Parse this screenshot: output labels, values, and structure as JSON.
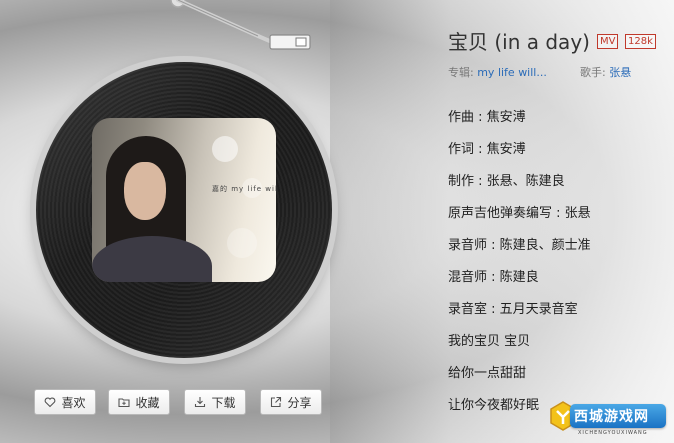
{
  "song": {
    "title": "宝贝 (in a day)",
    "badges": [
      "MV",
      "128k"
    ]
  },
  "meta": {
    "album_label": "专辑:",
    "album_value": "my life will...",
    "singer_label": "歌手:",
    "singer_value": "张悬"
  },
  "cover_text": "嘉的 my life will",
  "lyrics": [
    "作曲 : 焦安溥",
    "作词 : 焦安溥",
    "制作 : 张悬、陈建良",
    "原声吉他弹奏编写 : 张悬",
    "录音师 : 陈建良、颜士准",
    "混音师 : 陈建良",
    "录音室 : 五月天录音室",
    "我的宝贝 宝贝",
    "给你一点甜甜",
    "让你今夜都好眠"
  ],
  "actions": {
    "like": "喜欢",
    "collect": "收藏",
    "download": "下载",
    "share": "分享"
  },
  "icons": {
    "like": "heart-icon",
    "collect": "folder-plus-icon",
    "download": "download-icon",
    "share": "share-icon"
  },
  "colors": {
    "link": "#2a6bb8",
    "badge": "#c0392b",
    "watermark": "#1a72c4"
  },
  "watermark": {
    "text": "西城游戏网",
    "sub": "XICHENGYOUXIWANG"
  }
}
